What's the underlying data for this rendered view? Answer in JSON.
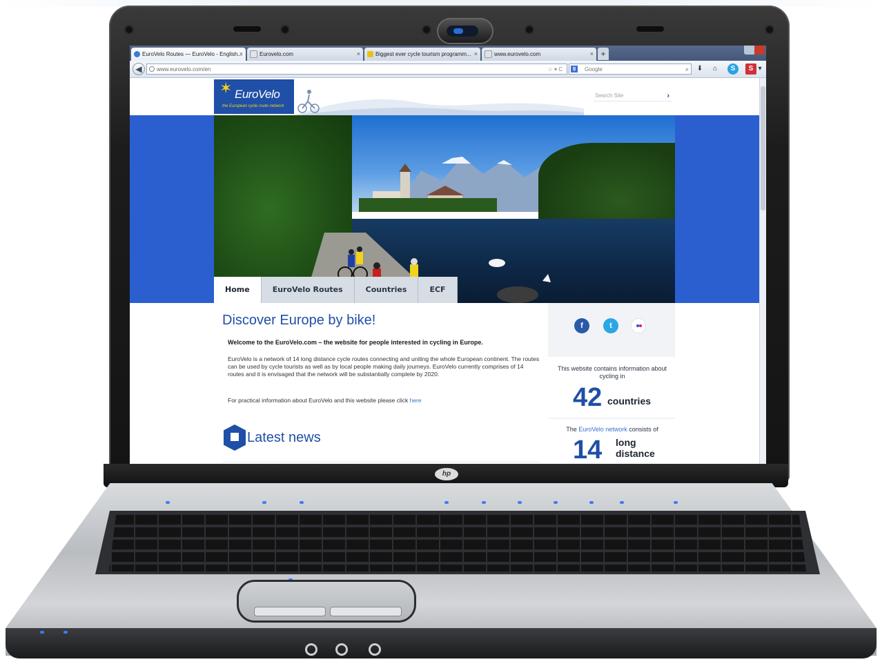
{
  "browser": {
    "tabs": [
      {
        "label": "EuroVelo Routes — EuroVelo - English...",
        "active": true,
        "favicon_color": "#3a7bd5"
      },
      {
        "label": "Eurovelo.com",
        "active": false,
        "favicon_color": "#e0e4ea"
      },
      {
        "label": "Biggest ever cycle tourism programm...",
        "active": false,
        "favicon_color": "#e8c21c"
      },
      {
        "label": "www.eurovelo.com",
        "active": false,
        "favicon_color": "#e0e4ea"
      }
    ],
    "tab_close_glyph": "×",
    "new_tab_glyph": "+",
    "url": "www.eurovelo.com/en",
    "url_tools": "☆ ▾ C",
    "search_engine_placeholder": "Google",
    "search_icon": "magnifier-icon",
    "toolbar_icons": [
      "download-icon",
      "home-icon",
      "skype-icon",
      "stumble-icon"
    ]
  },
  "site": {
    "logo_text": "EuroVelo",
    "logo_tagline": "the European cycle route network",
    "search_placeholder": "Search Site",
    "search_arrow": "›",
    "nav": [
      "Home",
      "EuroVelo Routes",
      "Countries",
      "ECF"
    ],
    "nav_active": "Home",
    "heading": "Discover Europe by bike!",
    "welcome": "Welcome to the EuroVelo.com – the website for people interested in cycling in Europe.",
    "intro": "EuroVelo is a network of 14 long distance cycle routes connecting and uniting the whole European continent. The routes can be used by cycle tourists as well as by local people making daily journeys. EuroVelo currently comprises of 14 routes and it is envisaged that the network will be substantially complete by 2020.",
    "practical_prefix": "For practical information about EuroVelo and this website please click ",
    "practical_link": "here",
    "news_heading": "Latest news",
    "social": [
      "f",
      "t"
    ],
    "social_icons": [
      "facebook-icon",
      "twitter-icon",
      "flickr-icon"
    ],
    "stat1_text": "This website contains information about cycling in",
    "stat1_number": "42",
    "stat1_word": "countries",
    "stat2_prefix": "The ",
    "stat2_link": "EuroVelo network",
    "stat2_suffix": " consists of",
    "stat2_number": "14",
    "stat2_word1": "long",
    "stat2_word2": "distance"
  },
  "laptop": {
    "brand_logo": "hp"
  },
  "colors": {
    "brand_blue": "#1f4fa6",
    "side_blue": "#2b5fd0",
    "logo_star": "#f6d11a"
  }
}
